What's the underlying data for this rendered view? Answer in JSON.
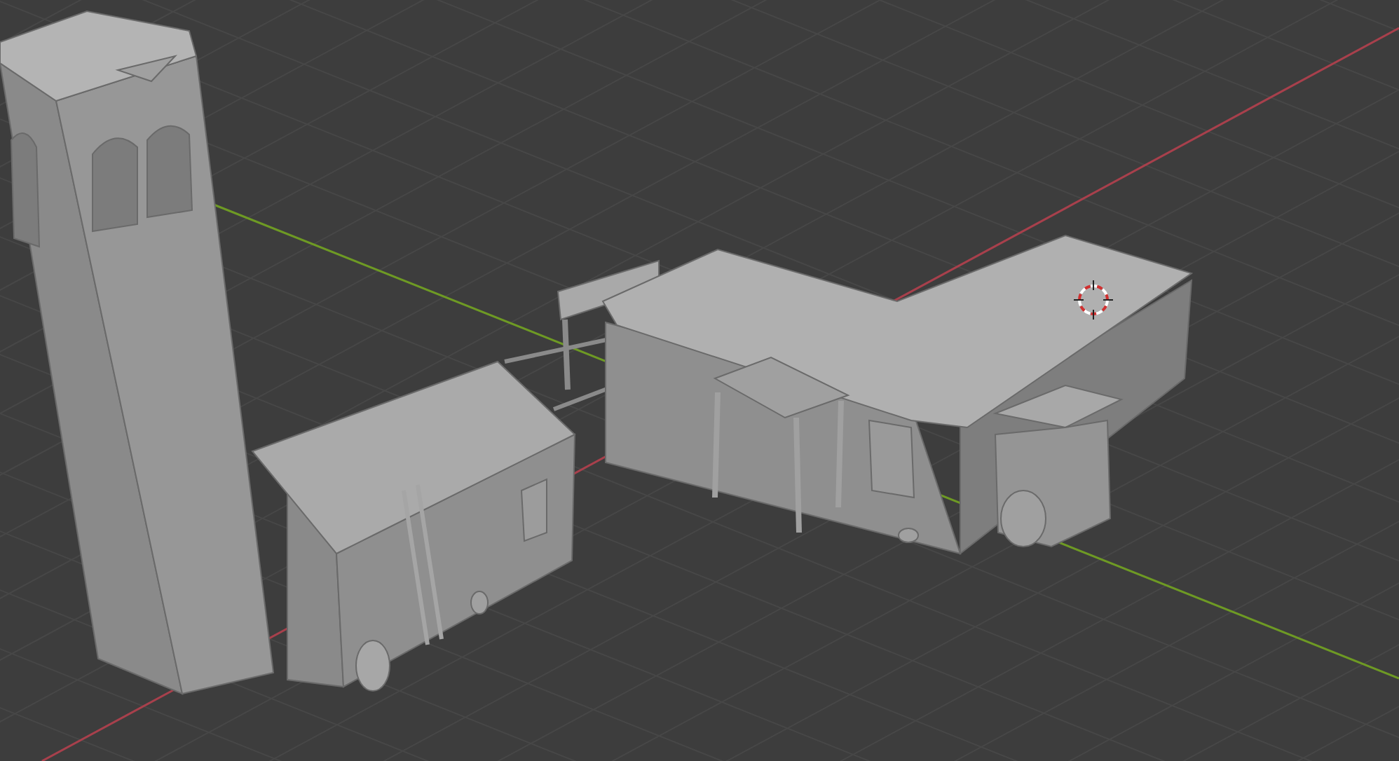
{
  "viewport": {
    "show_grid": true,
    "show_axes": true,
    "show_cursor": true
  }
}
